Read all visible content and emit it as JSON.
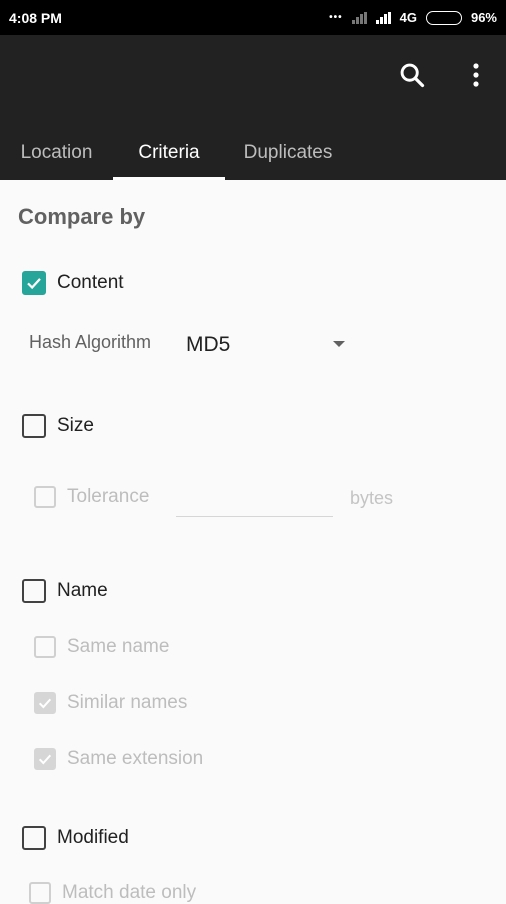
{
  "status_bar": {
    "time": "4:08 PM",
    "network": "4G",
    "battery": "96%"
  },
  "app_bar": {
    "search_icon": "search-icon",
    "more_icon": "more-vert-icon"
  },
  "tabs": [
    {
      "label": "Location",
      "active": false
    },
    {
      "label": "Criteria",
      "active": true
    },
    {
      "label": "Duplicates",
      "active": false
    }
  ],
  "compare": {
    "title": "Compare by",
    "content": {
      "label": "Content",
      "checked": true
    },
    "hash": {
      "label": "Hash Algorithm",
      "value": "MD5"
    },
    "size": {
      "label": "Size",
      "checked": false
    },
    "tolerance": {
      "label": "Tolerance",
      "value": "",
      "unit": "bytes"
    },
    "name": {
      "label": "Name",
      "checked": false
    },
    "same_name": {
      "label": "Same name",
      "checked": false
    },
    "similar_names": {
      "label": "Similar names",
      "checked": true
    },
    "same_extension": {
      "label": "Same extension",
      "checked": true
    },
    "modified": {
      "label": "Modified",
      "checked": false
    },
    "match_date_only": {
      "label": "Match date only",
      "checked": false
    }
  },
  "colors": {
    "accent": "#26a69a",
    "app_bar": "#222222",
    "background": "#fafafa"
  }
}
